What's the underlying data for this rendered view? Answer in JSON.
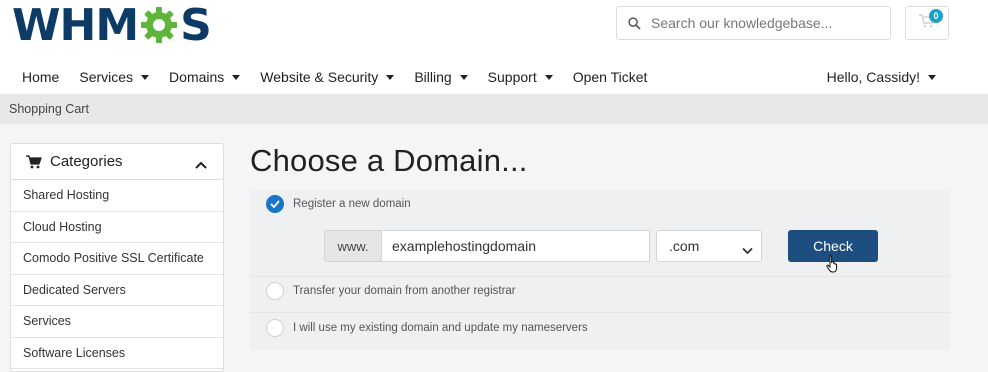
{
  "brand": {
    "logo_left": "WHM",
    "logo_right": "S"
  },
  "search": {
    "placeholder": "Search our knowledgebase..."
  },
  "cart": {
    "count": "0"
  },
  "nav": {
    "items": [
      {
        "label": "Home",
        "dropdown": false
      },
      {
        "label": "Services",
        "dropdown": true
      },
      {
        "label": "Domains",
        "dropdown": true
      },
      {
        "label": "Website & Security",
        "dropdown": true
      },
      {
        "label": "Billing",
        "dropdown": true
      },
      {
        "label": "Support",
        "dropdown": true
      },
      {
        "label": "Open Ticket",
        "dropdown": false
      }
    ],
    "account": "Hello, Cassidy!"
  },
  "breadcrumb": {
    "label": "Shopping Cart"
  },
  "sidebar": {
    "title": "Categories",
    "items": [
      "Shared Hosting",
      "Cloud Hosting",
      "Comodo Positive SSL Certificate",
      "Dedicated Servers",
      "Services",
      "Software Licenses"
    ]
  },
  "main": {
    "title": "Choose a Domain...",
    "options": [
      {
        "label": "Register a new domain",
        "selected": true
      },
      {
        "label": "Transfer your domain from another registrar",
        "selected": false
      },
      {
        "label": "I will use my existing domain and update my nameservers",
        "selected": false
      }
    ],
    "domain_prefix": "www.",
    "domain_value": "examplehostingdomain",
    "tld_value": ".com",
    "check_label": "Check"
  },
  "colors": {
    "brand_navy": "#0d3b66",
    "brand_green": "#5fb43b",
    "accent_blue": "#1976c9",
    "button_navy": "#1d4e7f",
    "badge_teal": "#1ba3c6"
  }
}
